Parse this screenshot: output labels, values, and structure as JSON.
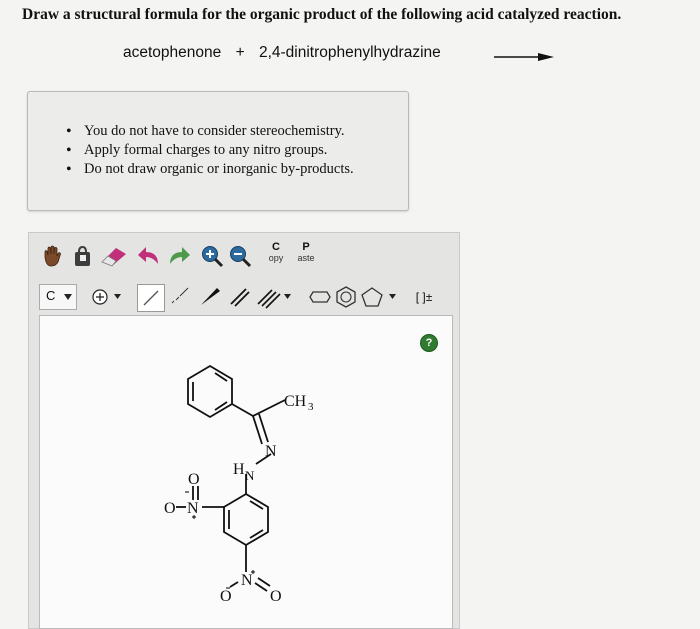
{
  "question": {
    "prompt": "Draw a structural formula for the organic product of the following acid catalyzed reaction."
  },
  "reaction": {
    "reactant1": "acetophenone",
    "plus": "+",
    "reactant2": "2,4-dinitrophenylhydrazine"
  },
  "instructions": {
    "items": [
      "You do not have to consider stereochemistry.",
      "Apply formal charges to any nitro groups.",
      "Do not draw organic or inorganic by-products."
    ]
  },
  "toolbar": {
    "copy_big": "C",
    "copy_small": "opy",
    "paste_big": "P",
    "paste_small": "aste",
    "element_selected": "C",
    "charge_label": "[ ]±"
  },
  "canvas": {
    "help_label": "?",
    "atoms": {
      "ch3": "CH",
      "ch3_sub": "3",
      "n_imine": "N",
      "hn": "H",
      "hn_n": "N",
      "nitro_left_o_top": "O",
      "nitro_left_n": "N",
      "nitro_left_o": "O",
      "nitro_bottom_n": "N",
      "nitro_bottom_o_left": "O",
      "nitro_bottom_o_right": "O"
    }
  },
  "colors": {
    "help_green": "#2f7b2f",
    "eraser_pink": "#c0307a",
    "arrow_green": "#4d9a4d"
  }
}
